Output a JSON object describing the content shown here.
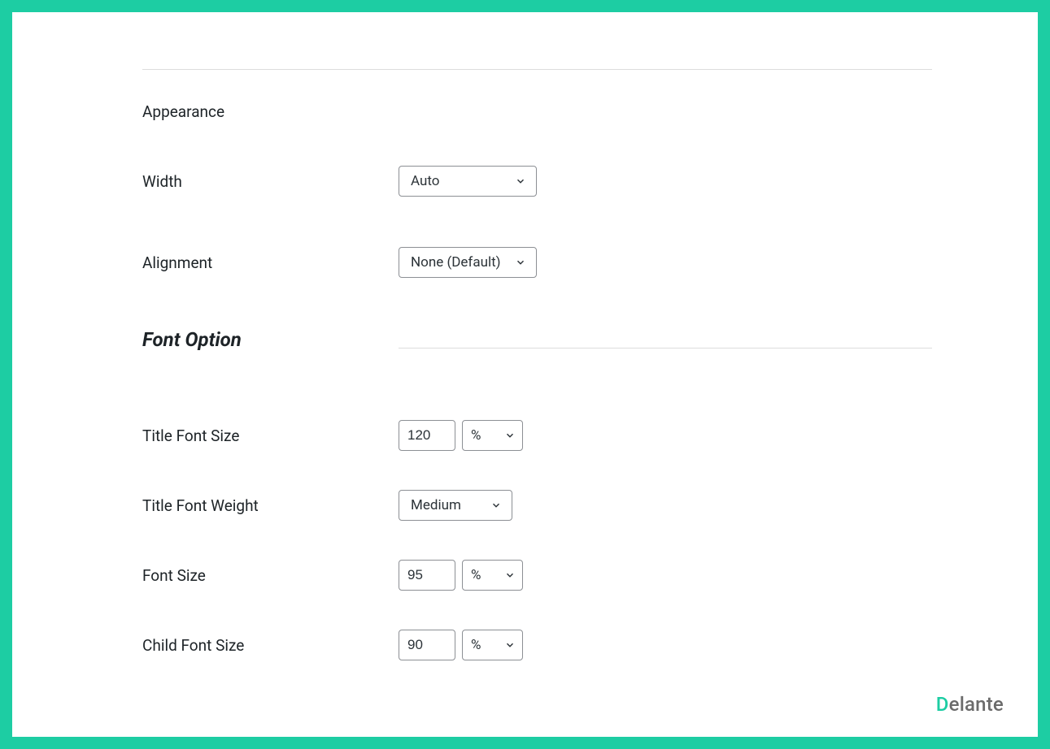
{
  "section": {
    "appearance_label": "Appearance",
    "font_option_title": "Font Option"
  },
  "fields": {
    "width": {
      "label": "Width",
      "value": "Auto"
    },
    "alignment": {
      "label": "Alignment",
      "value": "None (Default)"
    },
    "title_font_size": {
      "label": "Title Font Size",
      "value": "120",
      "unit": "%"
    },
    "title_font_weight": {
      "label": "Title Font Weight",
      "value": "Medium"
    },
    "font_size": {
      "label": "Font Size",
      "value": "95",
      "unit": "%"
    },
    "child_font_size": {
      "label": "Child Font Size",
      "value": "90",
      "unit": "%"
    }
  },
  "brand": {
    "first": "D",
    "rest": "elante"
  }
}
